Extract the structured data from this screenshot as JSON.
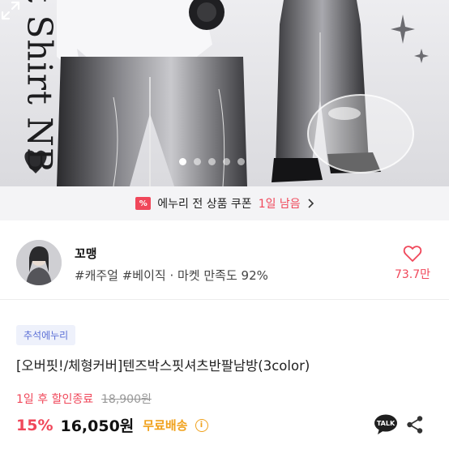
{
  "hero": {
    "vertical_title": "it Shirt NB",
    "carousel_dots": 5,
    "active_dot": 0
  },
  "coupon": {
    "icon_label": "%",
    "text": "에누리 전 상품 쿠폰",
    "remaining": "1일 남음"
  },
  "shop": {
    "name": "꼬맹",
    "meta": "#캐주얼 #베이직 · 마켓 만족도 92%",
    "like_count": "73.7만"
  },
  "product": {
    "badge": "추석에누리",
    "title": "[오버핏!/체형커버]텐즈박스핏셔츠반팔남방(3color)",
    "deadline": "1일 후 할인종료",
    "original_price": "18,900원",
    "discount": "15%",
    "price": "16,050원",
    "shipping": "무료배송",
    "info_icon": "i"
  },
  "icons": {
    "talk_label": "TALK"
  },
  "colors": {
    "accent_red": "#f0475a",
    "shipping_orange": "#f0a11c",
    "badge_blue": "#5b6fd6"
  }
}
